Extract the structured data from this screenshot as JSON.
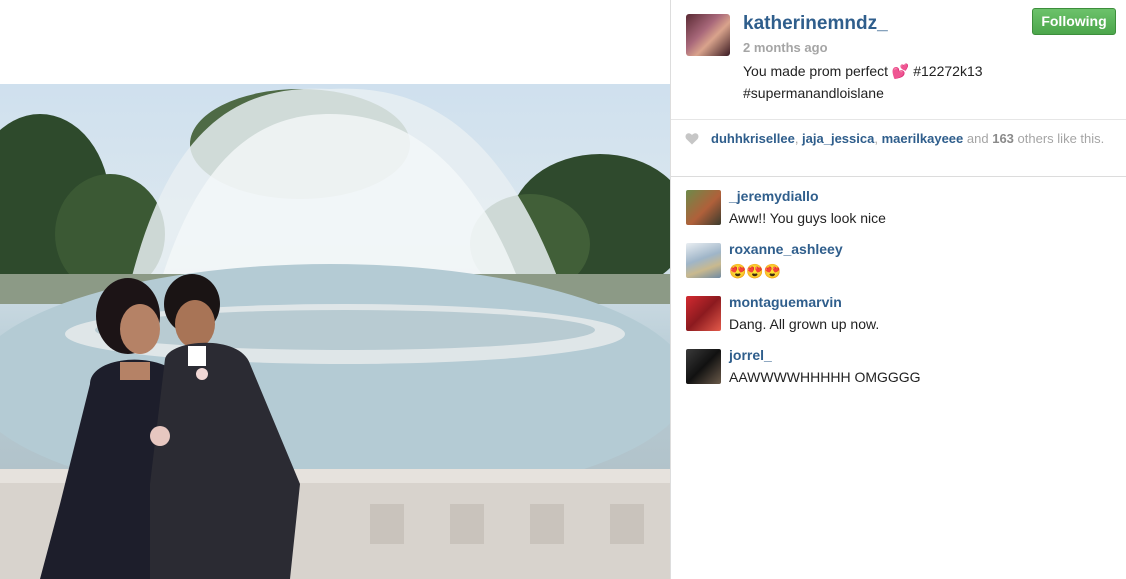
{
  "post": {
    "owner": "katherinemndz_",
    "time": "2 months ago",
    "caption_line1": "You made prom perfect 💕 #12272k13",
    "caption_line2": "#supermanandloislane",
    "follow_label": "Following",
    "follow_color": "#4ca64b"
  },
  "likes": {
    "users": [
      "duhhkrisellee",
      "jaja_jessica",
      "maerilkayeee"
    ],
    "separator": ", ",
    "and_text": "and",
    "count": "163",
    "others_text": "others like this."
  },
  "comments": [
    {
      "user": "_jeremydiallo",
      "text": "Aww!! You guys look nice",
      "avatar_color": "#8a6a3a"
    },
    {
      "user": "roxanne_ashleey",
      "text": "😍😍😍",
      "avatar_color": "#b8c8d8"
    },
    {
      "user": "montaguemarvin",
      "text": "Dang. All grown up now.",
      "avatar_color": "#c2282e"
    },
    {
      "user": "jorrel_",
      "text": "AAWWWWHHHHH OMGGGG",
      "avatar_color": "#2a2a2a"
    }
  ],
  "colors": {
    "link": "#2f5e8c",
    "muted": "#a5a5a5",
    "text": "#222222"
  },
  "icons": {
    "like": "heart-icon"
  }
}
